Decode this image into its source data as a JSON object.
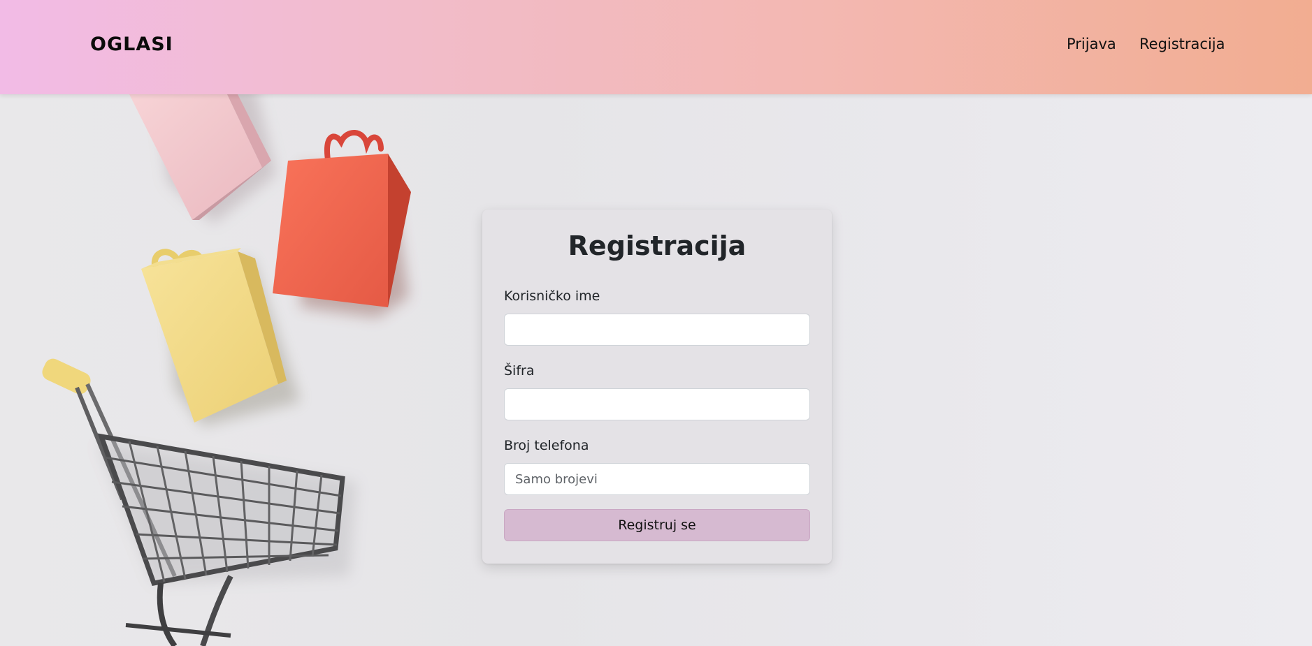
{
  "navbar": {
    "brand": "OGLASI",
    "links": [
      {
        "label": "Prijava"
      },
      {
        "label": "Registracija"
      }
    ]
  },
  "form": {
    "title": "Registracija",
    "fields": [
      {
        "label": "Korisničko ime",
        "value": "",
        "placeholder": ""
      },
      {
        "label": "Šifra",
        "value": "",
        "placeholder": ""
      },
      {
        "label": "Broj telefona",
        "value": "",
        "placeholder": "Samo brojevi"
      }
    ],
    "submit_label": "Registruj se"
  },
  "colors": {
    "navbar_gradient_start": "#f2bbe6",
    "navbar_gradient_end": "#f2ad91",
    "button_bg": "#d6bad1",
    "card_bg": "#e4e2e6"
  },
  "background": {
    "image": "shopping-illustration",
    "items": [
      "pink-bag-icon",
      "red-bag-icon",
      "yellow-bag-icon",
      "shopping-cart-icon"
    ]
  }
}
